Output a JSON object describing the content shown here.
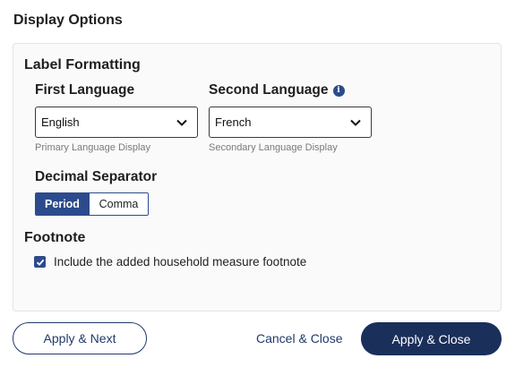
{
  "page": {
    "title": "Display Options"
  },
  "label_formatting": {
    "title": "Label Formatting",
    "first_language": {
      "label": "First Language",
      "value": "English",
      "helper": "Primary Language Display"
    },
    "second_language": {
      "label": "Second Language",
      "info_icon": "info-icon",
      "value": "French",
      "helper": "Secondary Language Display"
    },
    "decimal_separator": {
      "label": "Decimal Separator",
      "options": [
        "Period",
        "Comma"
      ],
      "selected": "Period"
    }
  },
  "footnote": {
    "title": "Footnote",
    "checkbox_label": "Include the added household measure footnote",
    "checked": true
  },
  "actions": {
    "apply_next": "Apply & Next",
    "cancel_close": "Cancel & Close",
    "apply_close": "Apply & Close"
  },
  "colors": {
    "accent": "#2c4b8c",
    "primary_button": "#1b2f5b",
    "panel_bg": "#fafafa",
    "helper_text": "#7a7a7a"
  }
}
